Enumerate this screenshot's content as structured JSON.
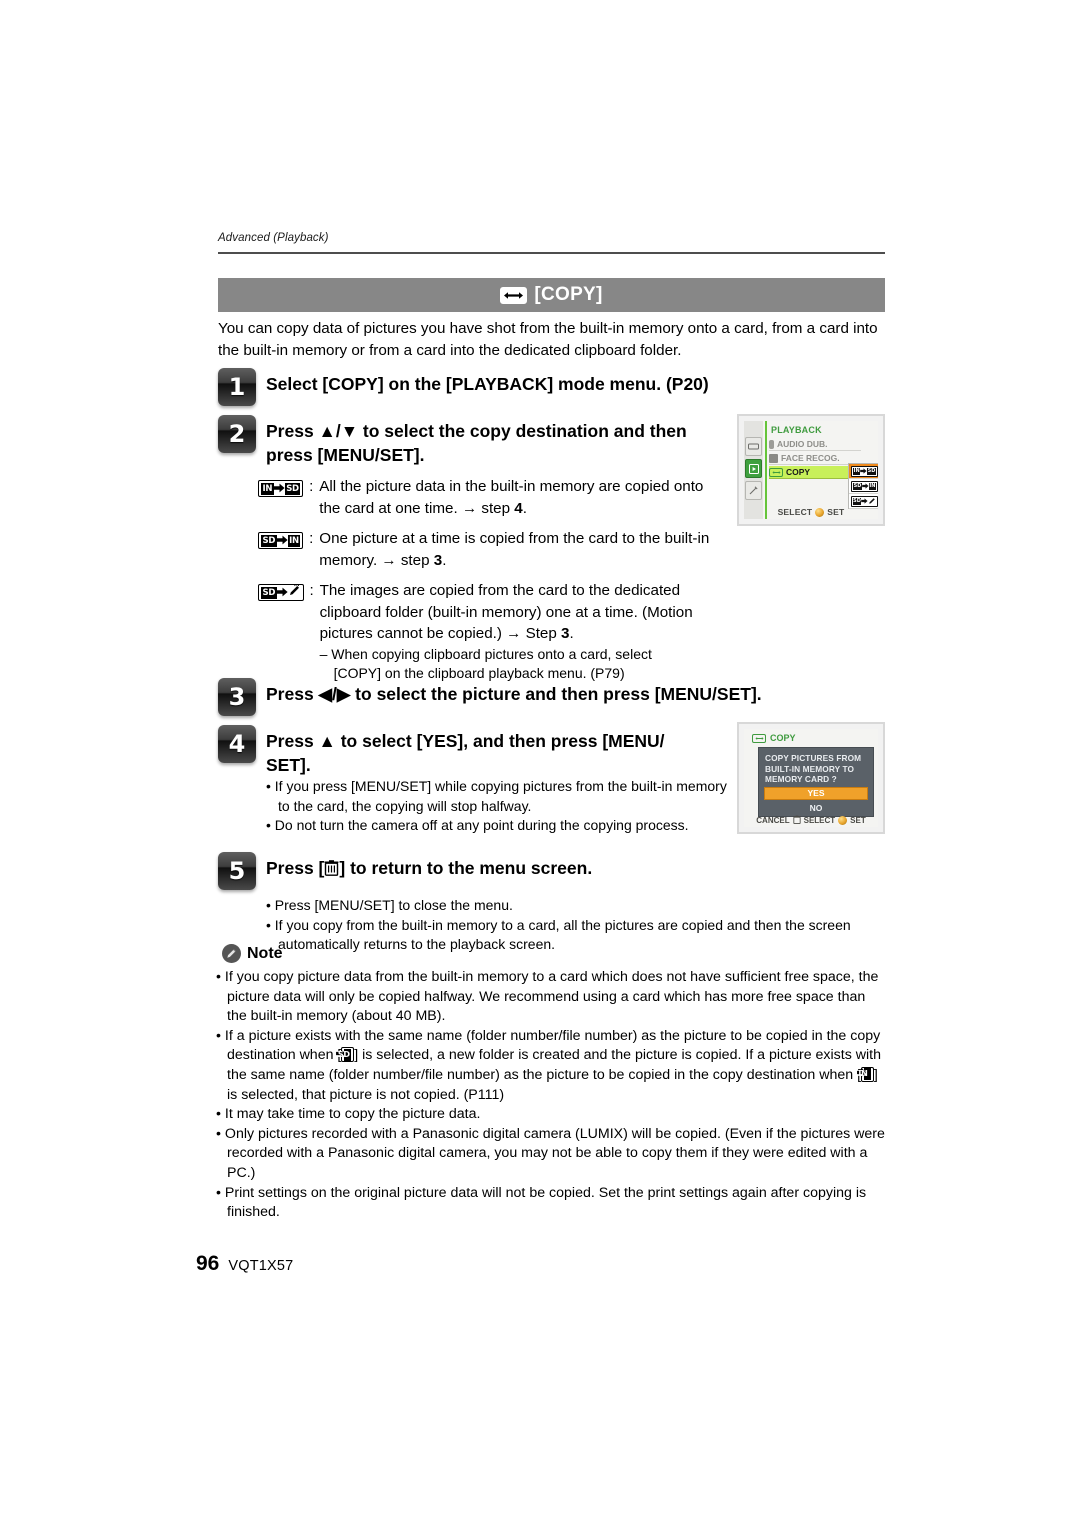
{
  "page": {
    "running_head": "Advanced (Playback)",
    "folio_number": "96",
    "folio_code": "VQT1X57"
  },
  "banner": {
    "icon": "copy-icon",
    "title": "[COPY]"
  },
  "intro": "You can copy data of pictures you have shot from the built-in memory onto a card, from a card into the built-in memory or from a card into the dedicated clipboard folder.",
  "steps": [
    {
      "number": "1",
      "title": "Select [COPY] on the [PLAYBACK] mode menu. (P20)"
    },
    {
      "number": "2",
      "title": "Press ▲/▼ to select the copy destination and then press [MENU/SET]."
    },
    {
      "number": "3",
      "title": "Press ◀/▶ to select the picture and then press [MENU/SET]."
    },
    {
      "number": "4",
      "title_line1": "Press ▲ to select [YES], and then press [MENU/",
      "title_line2": "SET]."
    },
    {
      "number": "5",
      "title_pre": "Press [",
      "title_post": "] to return to the menu screen.",
      "icon": "trash-icon"
    }
  ],
  "destinations": [
    {
      "icon": "in-to-sd-icon",
      "from": "IN",
      "to": "SD",
      "text": "All the picture data in the built-in memory are copied onto the card at one time. → step ",
      "step_ref": "4",
      "tail": "."
    },
    {
      "icon": "sd-to-in-icon",
      "from": "SD",
      "to": "IN",
      "text": "One picture at a time is copied from the card to the built-in memory. → step ",
      "step_ref": "3",
      "tail": "."
    },
    {
      "icon": "sd-to-clipboard-icon",
      "from": "SD",
      "to": "CLIPBOARD",
      "text": "The images are copied from the card to the dedicated clipboard folder (built-in memory) one at a time. (Motion pictures cannot be copied.) → Step ",
      "step_ref": "3",
      "tail": ".",
      "sub_dash_line1": "– When copying clipboard pictures onto a card, select",
      "sub_dash_line2": "[COPY] on the clipboard playback menu. (P79)"
    }
  ],
  "step4_bullets": [
    "• If you press [MENU/SET] while copying pictures from the built-in memory to the card, the copying will stop halfway.",
    "• Do not turn the camera off at any point during the copying process."
  ],
  "step5_bullets": [
    "• Press [MENU/SET] to close the menu.",
    "• If you copy from the built-in memory to a card, all the pictures are copied and then the screen automatically returns to the playback screen."
  ],
  "note": {
    "icon": "note-pencil-icon",
    "label": "Note",
    "bullets": [
      "• If you copy picture data from the built-in memory to a card which does not have sufficient free space, the picture data will only be copied halfway. We recommend using a card which has more free space than the built-in memory (about 40 MB).",
      "• It may take time to copy the picture data.",
      "• Only pictures recorded with a Panasonic digital camera (LUMIX) will be copied. (Even if the pictures were recorded with a Panasonic digital camera, you may not be able to copy them if they were edited with a PC.)",
      "• Print settings on the original picture data will not be copied. Set the print settings again after copying is finished."
    ],
    "mixed_bullet": {
      "seg1": "• If a picture exists with the same name (folder number/file number) as the picture to be copied in the copy destination when [",
      "seg2": "] is selected, a new folder is created and the picture is copied. If a picture exists with the same name (folder number/file number) as the picture to be copied in the copy destination when [",
      "seg3": "] is selected, that picture is not copied. (P111)"
    }
  },
  "lcd_menu": {
    "title": "PLAYBACK",
    "rows": [
      {
        "label": "AUDIO DUB.",
        "icon": "microphone-icon",
        "selected": false
      },
      {
        "label": "FACE RECOG.",
        "icon": "face-recognition-icon",
        "selected": false
      },
      {
        "label": "COPY",
        "icon": "copy-icon",
        "selected": true
      }
    ],
    "submenu": [
      {
        "icon": "in-to-sd-icon",
        "from": "IN",
        "to": "SD",
        "selected": true
      },
      {
        "icon": "sd-to-in-icon",
        "from": "SD",
        "to": "IN",
        "selected": false
      },
      {
        "icon": "sd-to-clipboard-icon",
        "from": "SD",
        "to": "CLIP",
        "selected": false
      }
    ],
    "footer_select": "SELECT",
    "footer_set": "SET",
    "tabs": [
      "rec-tab",
      "playback-tab",
      "setup-tab"
    ]
  },
  "lcd_confirm": {
    "header": "COPY",
    "message_line1": "COPY PICTURES FROM",
    "message_line2": "BUILT-IN MEMORY TO",
    "message_line3": "MEMORY CARD ?",
    "option_yes": "YES",
    "option_no": "NO",
    "footer_cancel": "CANCEL",
    "footer_select": "SELECT",
    "footer_set": "SET"
  },
  "colors": {
    "banner_gray": "#878787",
    "menu_green": "#3f9b3f",
    "highlight_green": "#c8f05a",
    "highlight_orange": "#f08a1c",
    "dialog_gray": "#5a6168"
  }
}
